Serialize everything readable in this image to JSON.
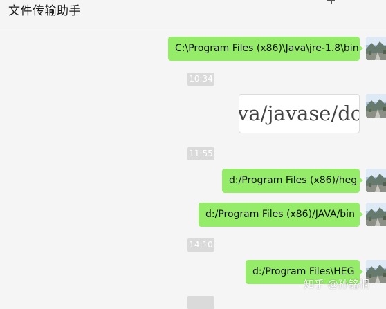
{
  "header": {
    "title": "文件传输助手",
    "add_icon": "plus-icon"
  },
  "messages": [
    {
      "type": "text",
      "text": "C:\\Program Files (x86)\\Java\\jre-1.8\\bin"
    },
    {
      "type": "timestamp",
      "text": "10:34"
    },
    {
      "type": "image",
      "text": "va/javase/dov"
    },
    {
      "type": "timestamp",
      "text": "11:55"
    },
    {
      "type": "text",
      "text": "d:/Program Files (x86)/heg"
    },
    {
      "type": "text",
      "text": "d:/Program Files (x86)/JAVA/bin"
    },
    {
      "type": "timestamp",
      "text": "14:10"
    },
    {
      "type": "text",
      "text": "d:/Program Files\\HEG"
    }
  ],
  "watermark": "知乎 @孙铭桐",
  "colors": {
    "bubble": "#95ec69",
    "background": "#f5f5f5",
    "timestamp_bg": "#dadada"
  }
}
